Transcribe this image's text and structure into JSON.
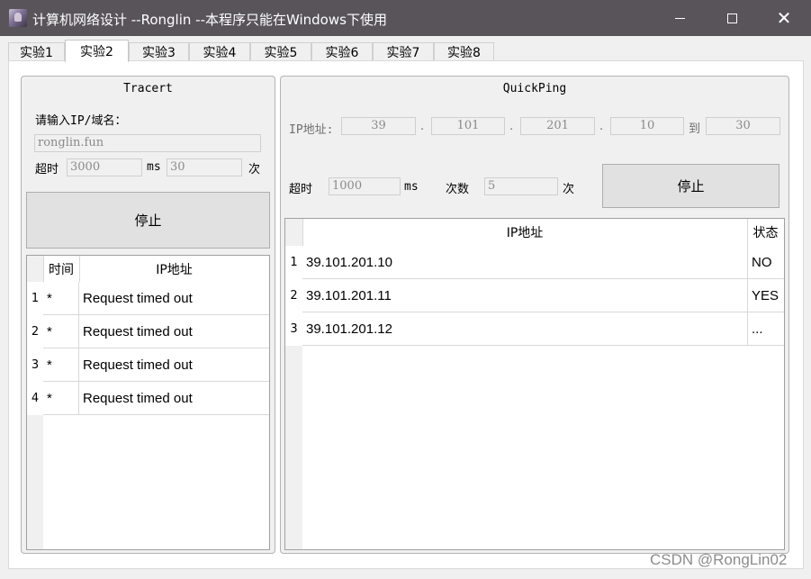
{
  "window": {
    "title": "计算机网络设计 --Ronglin  --本程序只能在Windows下使用",
    "minimize": "",
    "maximize": "",
    "close": "✕"
  },
  "tabs": [
    "实验1",
    "实验2",
    "实验3",
    "实验4",
    "实验5",
    "实验6",
    "实验7",
    "实验8"
  ],
  "active_tab": "实验2",
  "tracert": {
    "title": "Tracert",
    "prompt": "请输入IP/域名：",
    "host_value": "ronglin.fun",
    "timeout_label": "超时",
    "timeout_value": "3000",
    "timeout_unit": "ms",
    "count_value": "30",
    "count_unit": "次",
    "stop_button": "停止",
    "headers": [
      "时间",
      "IP地址"
    ],
    "rows": [
      {
        "index": "1",
        "time": "*",
        "ip": "Request timed out"
      },
      {
        "index": "2",
        "time": "*",
        "ip": "Request timed out"
      },
      {
        "index": "3",
        "time": "*",
        "ip": "Request timed out"
      },
      {
        "index": "4",
        "time": "*",
        "ip": "Request timed out"
      }
    ]
  },
  "quickping": {
    "title": "QuickPing",
    "ip_label": "IP地址:",
    "ip1": "39",
    "ip2": "101",
    "ip3": "201",
    "ip4": "10",
    "dot": ".",
    "to_label": "到",
    "ip_end": "30",
    "timeout_label": "超时",
    "timeout_value": "1000",
    "timeout_unit": "ms",
    "count_label": "次数",
    "count_value": "5",
    "count_unit": "次",
    "stop_button": "停止",
    "headers": [
      "IP地址",
      "状态"
    ],
    "rows": [
      {
        "index": "1",
        "ip": "39.101.201.10",
        "status": "NO"
      },
      {
        "index": "2",
        "ip": "39.101.201.11",
        "status": "YES"
      },
      {
        "index": "3",
        "ip": "39.101.201.12",
        "status": "..."
      }
    ]
  },
  "watermark": "CSDN @RongLin02"
}
